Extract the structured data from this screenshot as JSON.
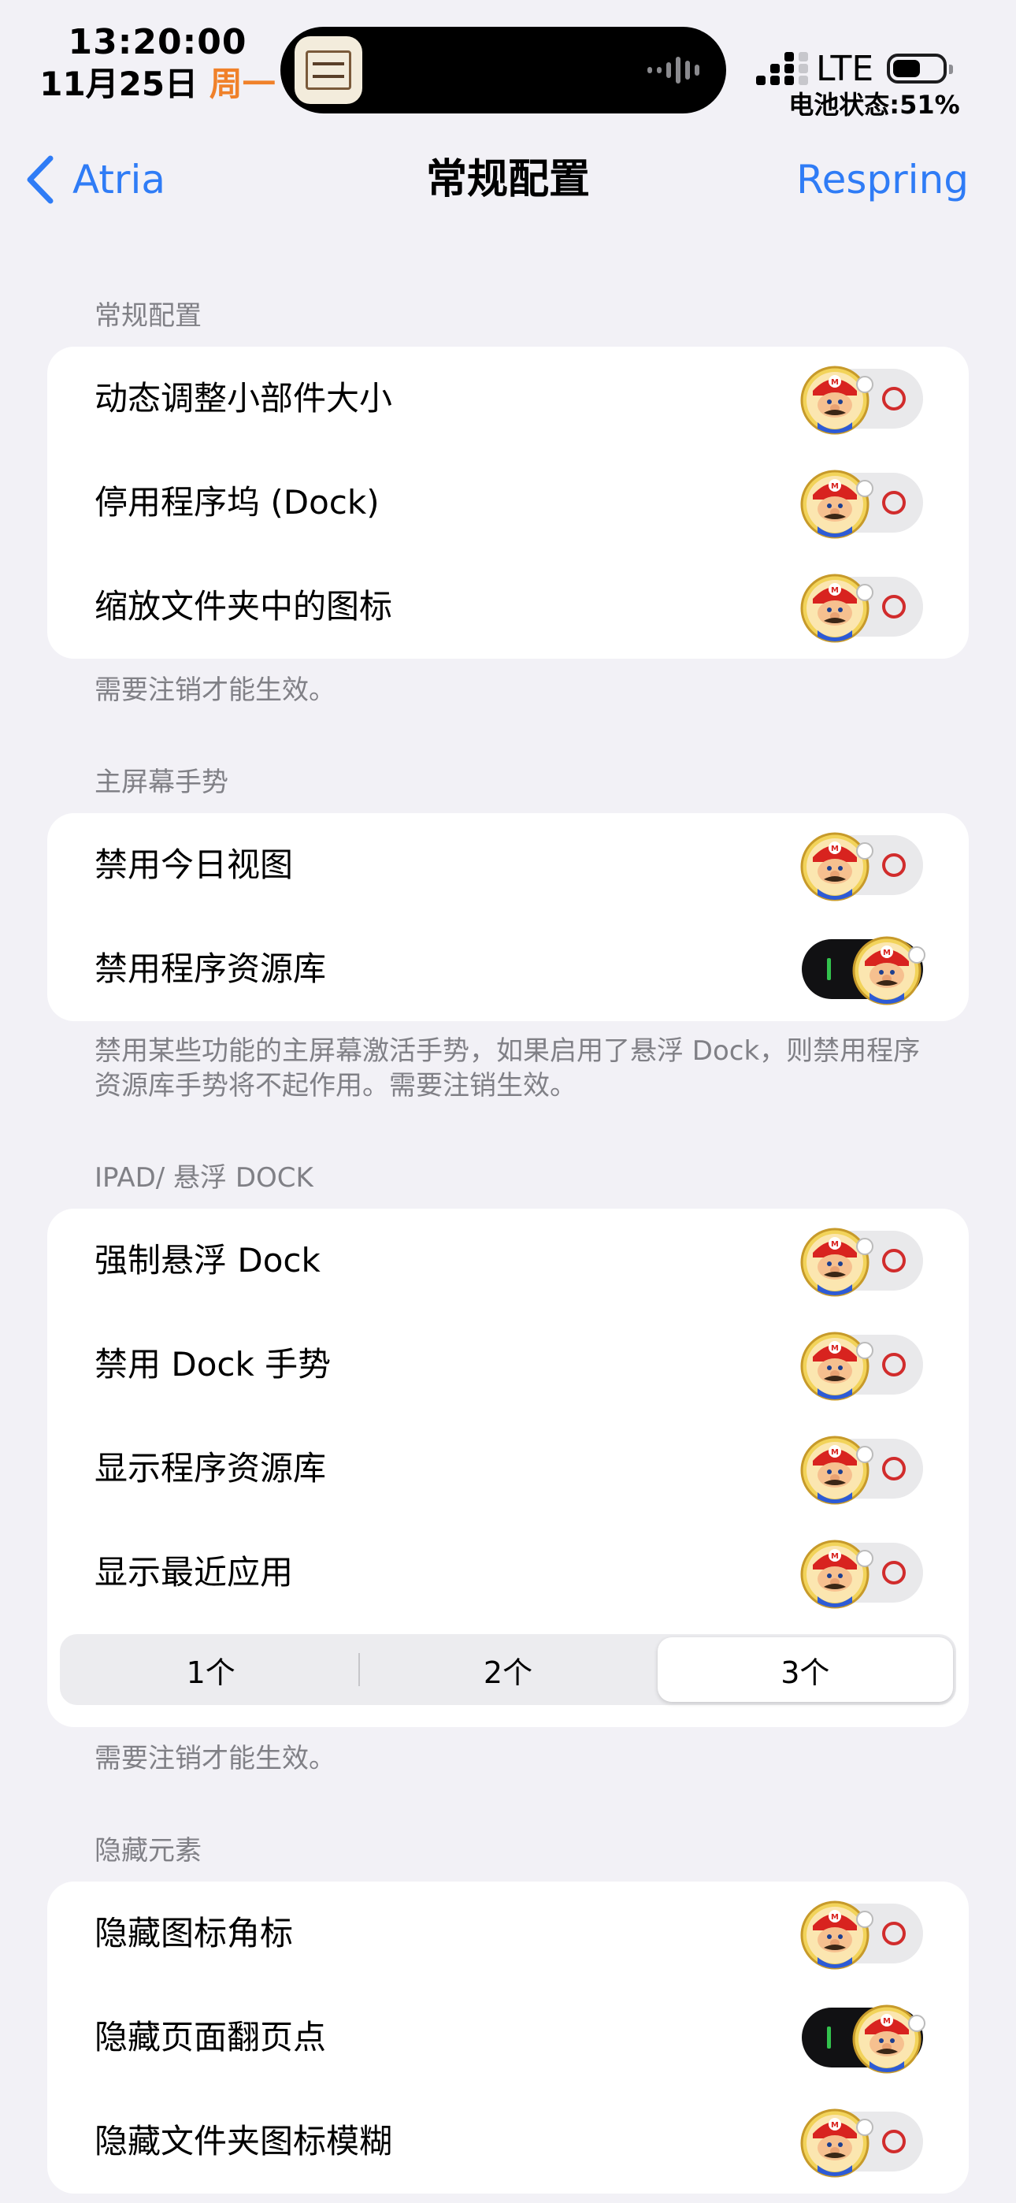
{
  "status_bar": {
    "time": "13:20:00",
    "date": "11月25日",
    "weekday": "周一",
    "network": "LTE",
    "battery_status": "电池状态:51%",
    "battery_level": 0.51
  },
  "nav": {
    "back_label": "Atria",
    "title": "常规配置",
    "action_label": "Respring"
  },
  "sections": [
    {
      "header": "常规配置",
      "rows": [
        {
          "label": "动态调整小部件大小",
          "on": false
        },
        {
          "label": "停用程序坞 (Dock)",
          "on": false
        },
        {
          "label": "缩放文件夹中的图标",
          "on": false
        }
      ],
      "footer": "需要注销才能生效。"
    },
    {
      "header": "主屏幕手势",
      "rows": [
        {
          "label": "禁用今日视图",
          "on": false
        },
        {
          "label": "禁用程序资源库",
          "on": true
        }
      ],
      "footer": "禁用某些功能的主屏幕激活手势，如果启用了悬浮 Dock，则禁用程序资源库手势将不起作用。需要注销生效。"
    },
    {
      "header": "IPAD/ 悬浮 DOCK",
      "rows": [
        {
          "label": "强制悬浮 Dock",
          "on": false
        },
        {
          "label": "禁用 Dock 手势",
          "on": false
        },
        {
          "label": "显示程序资源库",
          "on": false
        },
        {
          "label": "显示最近应用",
          "on": false
        }
      ],
      "segmented": {
        "options": [
          "1个",
          "2个",
          "3个"
        ],
        "selected_index": 2
      },
      "footer": "需要注销才能生效。"
    },
    {
      "header": "隐藏元素",
      "rows": [
        {
          "label": "隐藏图标角标",
          "on": false
        },
        {
          "label": "隐藏页面翻页点",
          "on": true
        },
        {
          "label": "隐藏文件夹图标模糊",
          "on": false
        }
      ]
    }
  ],
  "colors": {
    "accent": "#2f7cf6",
    "weekday": "#f0812a",
    "background": "#f2f1f6",
    "toggle_off_track": "#e9e9eb",
    "toggle_on_track": "#111113"
  },
  "icons": {
    "back": "chevron-left-icon",
    "toggle_knob": "mario-knob-icon",
    "signal": "cellular-signal-icon",
    "battery": "battery-icon"
  }
}
